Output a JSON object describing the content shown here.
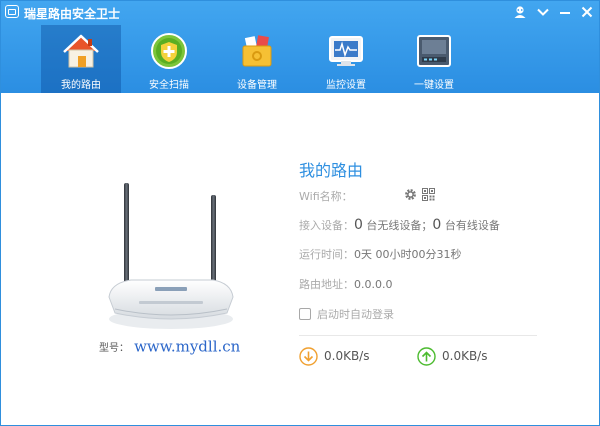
{
  "window": {
    "title": "瑞星路由安全卫士"
  },
  "nav": {
    "tabs": [
      {
        "label": "我的路由",
        "icon": "house-icon",
        "active": true
      },
      {
        "label": "安全扫描",
        "icon": "shield-plus-icon"
      },
      {
        "label": "设备管理",
        "icon": "toolbox-icon"
      },
      {
        "label": "监控设置",
        "icon": "monitor-pulse-icon"
      },
      {
        "label": "一键设置",
        "icon": "router-panel-icon"
      }
    ]
  },
  "router": {
    "title": "我的路由",
    "wifi_label": "Wifi名称：",
    "devices_label": "接入设备：",
    "wireless_count": "0",
    "wireless_text": "台无线设备；",
    "wired_count": "0",
    "wired_text": "台有线设备",
    "uptime_label": "运行时间：",
    "uptime_value": "0天 00小时00分31秒",
    "address_label": "路由地址：",
    "address_value": "0.0.0.0",
    "autologin_label": "启动时自动登录",
    "autologin_checked": false,
    "model_label": "型号：",
    "model_value": "www.mydll.cn"
  },
  "speeds": {
    "download": "0.0KB/s",
    "upload": "0.0KB/s"
  },
  "colors": {
    "header_blue": "#2b8ee2",
    "title_blue": "#2e8fe0",
    "download_orange": "#f0a030",
    "upload_green": "#4cbb2f"
  }
}
